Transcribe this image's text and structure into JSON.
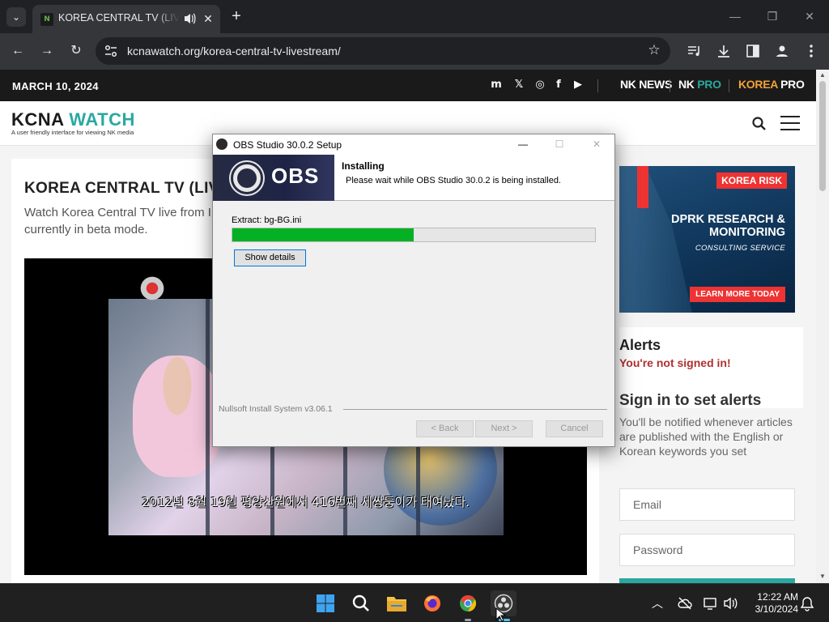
{
  "browser": {
    "tab_title": "KOREA CENTRAL TV (LIVESTREAM)",
    "tab_favicon": "N",
    "url": "kcnawatch.org/korea-central-tv-livestream/"
  },
  "site": {
    "date": "MARCH 10, 2024",
    "social": [
      "m",
      "𝕏",
      "◎",
      "f",
      "▶"
    ],
    "brands": {
      "nknews": "NK NEWS",
      "nkpro_nk": "NK",
      "nkpro_pro": "PRO",
      "korea": "KOREA",
      "korea_pro": "PRO"
    },
    "logo_kcna": "KCNA",
    "logo_watch": "WATCH",
    "logo_tagline": "A user friendly interface for viewing NK media"
  },
  "article": {
    "title": "KOREA CENTRAL TV (LIVE",
    "desc_line1": "Watch Korea Central TV live from I",
    "desc_line2": "currently in beta mode.",
    "video_subtitle": "2012년 8월 19일 평양산원에서 416번째 세쌍둥이가 태여났다."
  },
  "ad": {
    "logo": "KOREA RISK",
    "title": "DPRK RESEARCH & MONITORING",
    "subtitle": "CONSULTING SERVICE",
    "button": "LEARN MORE TODAY"
  },
  "alerts": {
    "title": "Alerts",
    "note": "You're not signed in!",
    "signin_title": "Sign in to set alerts",
    "signin_desc": "You'll be notified whenever articles are published with the English or Korean keywords you set",
    "email_label": "Email",
    "password_label": "Password"
  },
  "dialog": {
    "title": "OBS Studio 30.0.2 Setup",
    "banner_word": "OBS",
    "header_title": "Installing",
    "header_sub": "Please wait while OBS Studio 30.0.2 is being installed.",
    "extract": "Extract: bg-BG.ini",
    "progress": 0.5,
    "show_details": "Show details",
    "nsis": "Nullsoft Install System v3.06.1",
    "back": "< Back",
    "next": "Next >",
    "cancel": "Cancel"
  },
  "taskbar": {
    "time": "12:22 AM",
    "date": "3/10/2024"
  },
  "colors": {
    "progress_green": "#06b025",
    "teal_accent": "#2aa8a0",
    "alert_red": "#b03030"
  }
}
